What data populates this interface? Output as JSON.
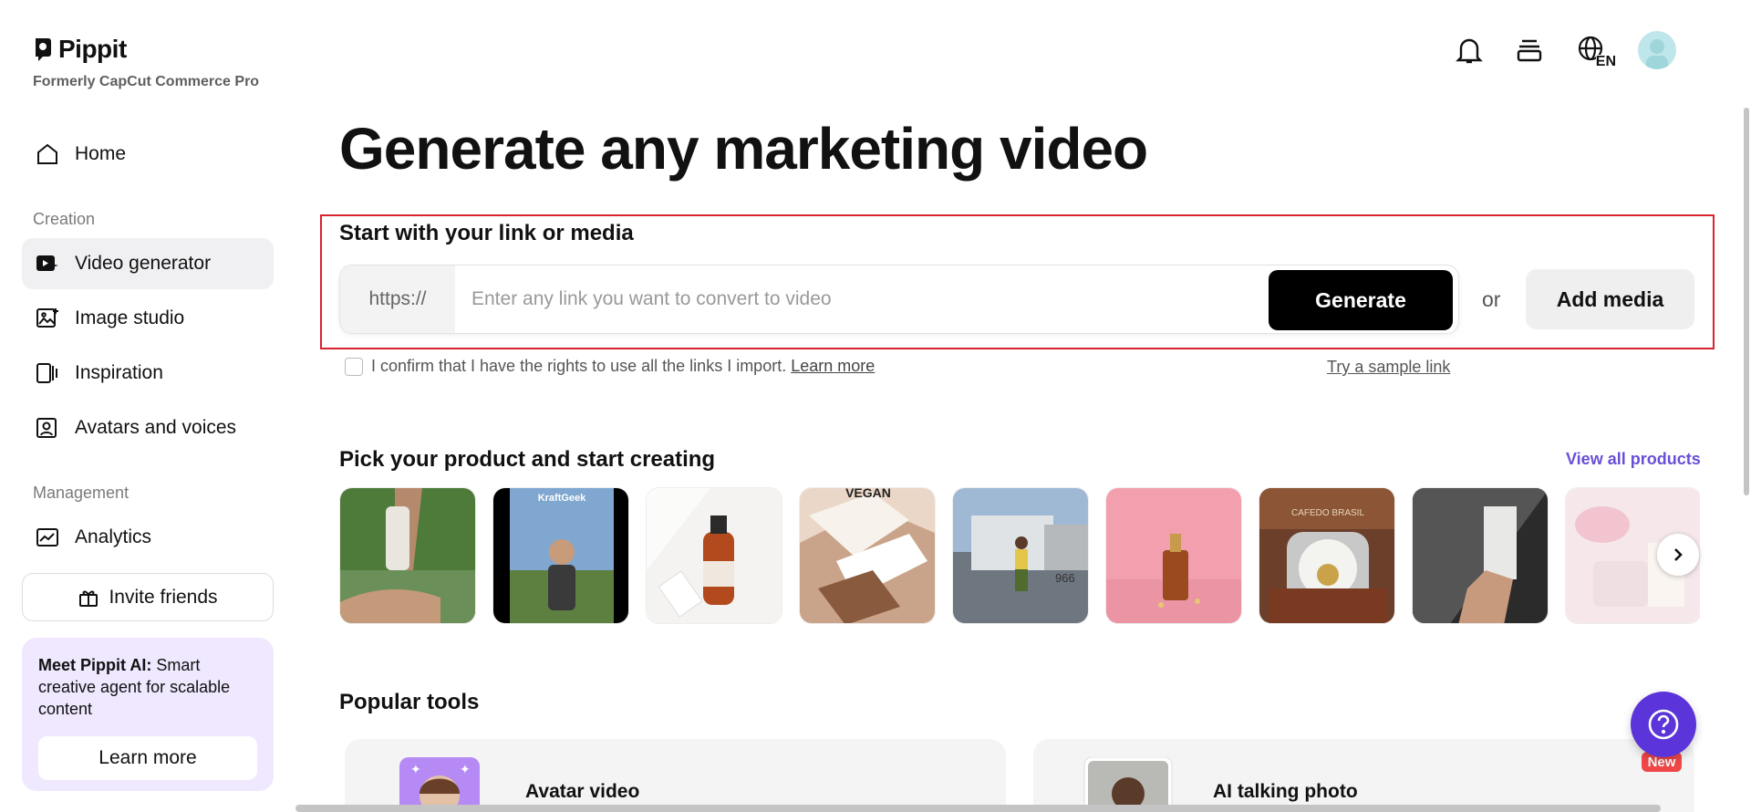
{
  "brand": {
    "name": "Pippit",
    "subtitle": "Formerly CapCut Commerce Pro"
  },
  "sidebar": {
    "home": "Home",
    "creation_label": "Creation",
    "creation_items": [
      {
        "label": "Video generator",
        "icon": "video-generator-icon",
        "active": true
      },
      {
        "label": "Image studio",
        "icon": "image-studio-icon"
      },
      {
        "label": "Inspiration",
        "icon": "inspiration-icon"
      },
      {
        "label": "Avatars and voices",
        "icon": "avatar-icon"
      }
    ],
    "management_label": "Management",
    "analytics": "Analytics",
    "invite": "Invite friends",
    "promo": {
      "title": "Meet Pippit AI:",
      "body": " Smart creative agent for scalable content",
      "button": "Learn more"
    }
  },
  "header": {
    "language": "EN"
  },
  "main": {
    "title": "Generate any marketing video",
    "start_label": "Start with your link or media",
    "url_prefix": "https://",
    "url_placeholder": "Enter any link you want to convert to video",
    "url_value": "",
    "generate": "Generate",
    "or": "or",
    "add_media": "Add media",
    "confirm_text": "I confirm that I have the rights to use all the links I import.",
    "confirm_link": "Learn more",
    "sample_link": "Try a sample link",
    "products_title": "Pick your product and start creating",
    "view_all": "View all products",
    "thumb_text_1": "KraftGeek",
    "thumb_text_2": "VEGAN",
    "thumb_text_3": "966",
    "thumb_text_4": "CAFEDO BRASIL",
    "popular_title": "Popular tools",
    "tools": [
      {
        "name": "Avatar video"
      },
      {
        "name": "AI talking photo",
        "badge": "New"
      }
    ]
  },
  "colors": {
    "accent": "#5b35d9",
    "highlight_border": "#d9232d",
    "link": "#6a4fd8"
  }
}
